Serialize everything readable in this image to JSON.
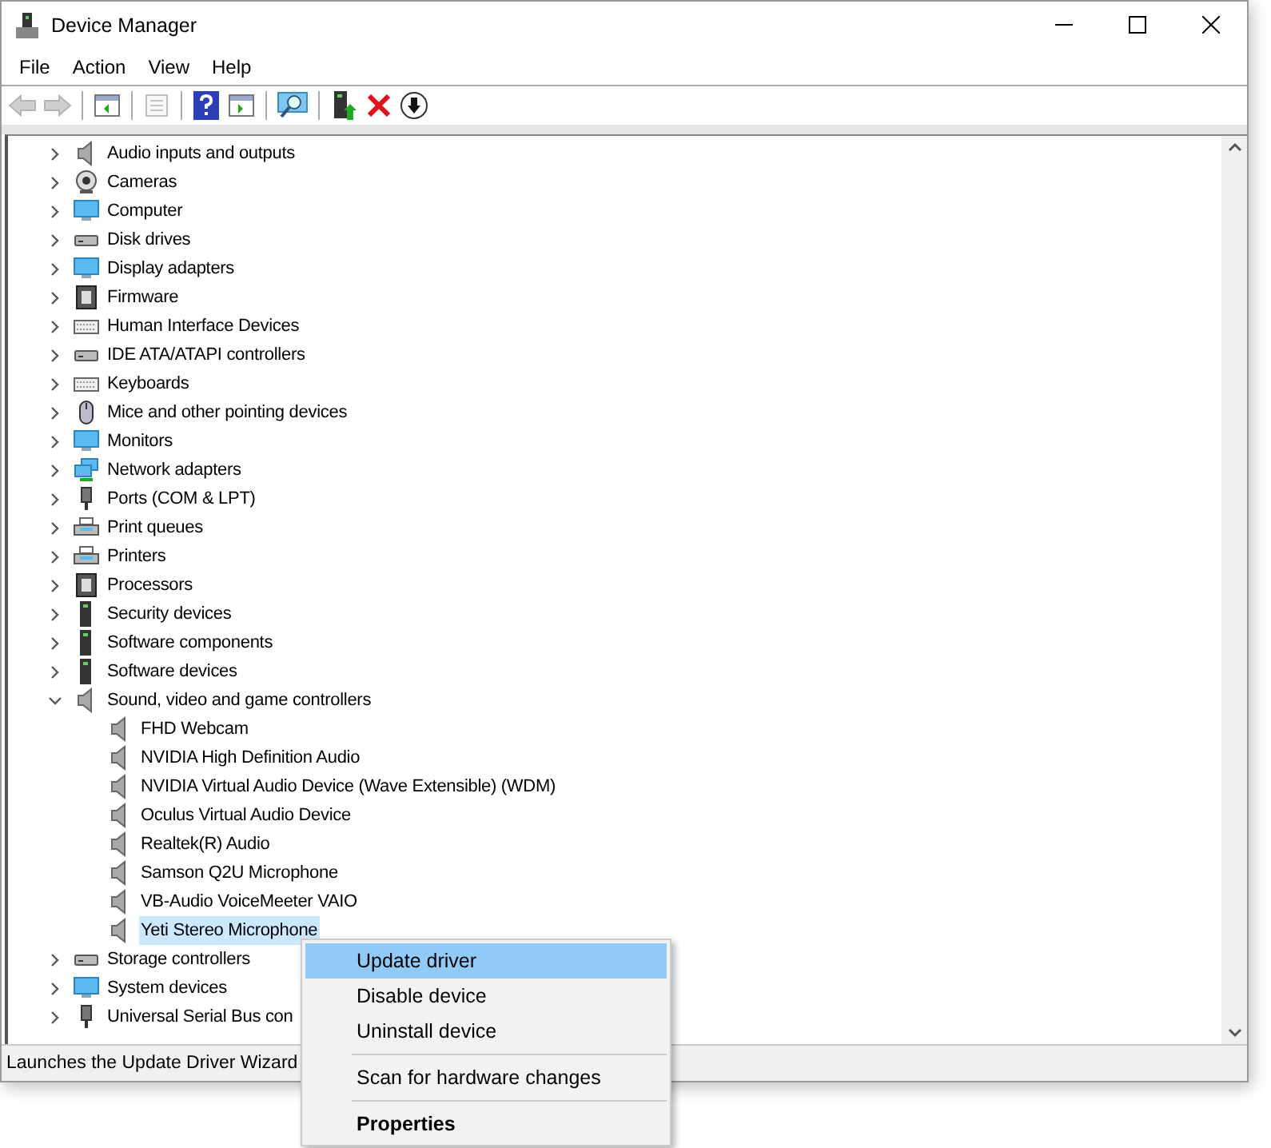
{
  "window": {
    "title": "Device Manager"
  },
  "menu": [
    "File",
    "Action",
    "View",
    "Help"
  ],
  "toolbar": [
    {
      "kind": "back",
      "disabled": true
    },
    {
      "kind": "forward",
      "disabled": true
    },
    {
      "kind": "separator"
    },
    {
      "kind": "tree",
      "disabled": false
    },
    {
      "kind": "separator"
    },
    {
      "kind": "properties",
      "disabled": true
    },
    {
      "kind": "separator"
    },
    {
      "kind": "help",
      "disabled": false
    },
    {
      "kind": "pane",
      "disabled": false
    },
    {
      "kind": "separator"
    },
    {
      "kind": "scan",
      "disabled": false
    },
    {
      "kind": "separator"
    },
    {
      "kind": "update",
      "disabled": false
    },
    {
      "kind": "uninstall",
      "disabled": false
    },
    {
      "kind": "disable",
      "disabled": false
    }
  ],
  "tree": [
    {
      "label": "Audio inputs and outputs",
      "expanded": false,
      "selected": false
    },
    {
      "label": "Cameras",
      "expanded": false,
      "selected": false
    },
    {
      "label": "Computer",
      "expanded": false,
      "selected": false
    },
    {
      "label": "Disk drives",
      "expanded": false,
      "selected": false
    },
    {
      "label": "Display adapters",
      "expanded": false,
      "selected": false
    },
    {
      "label": "Firmware",
      "expanded": false,
      "selected": false
    },
    {
      "label": "Human Interface Devices",
      "expanded": false,
      "selected": false
    },
    {
      "label": "IDE ATA/ATAPI controllers",
      "expanded": false,
      "selected": false
    },
    {
      "label": "Keyboards",
      "expanded": false,
      "selected": false
    },
    {
      "label": "Mice and other pointing devices",
      "expanded": false,
      "selected": false
    },
    {
      "label": "Monitors",
      "expanded": false,
      "selected": false
    },
    {
      "label": "Network adapters",
      "expanded": false,
      "selected": false
    },
    {
      "label": "Ports (COM & LPT)",
      "expanded": false,
      "selected": false
    },
    {
      "label": "Print queues",
      "expanded": false,
      "selected": false
    },
    {
      "label": "Printers",
      "expanded": false,
      "selected": false
    },
    {
      "label": "Processors",
      "expanded": false,
      "selected": false
    },
    {
      "label": "Security devices",
      "expanded": false,
      "selected": false
    },
    {
      "label": "Software components",
      "expanded": false,
      "selected": false
    },
    {
      "label": "Software devices",
      "expanded": false,
      "selected": false
    },
    {
      "label": "Sound, video and game controllers",
      "expanded": true,
      "selected": false,
      "children": [
        {
          "label": "FHD Webcam",
          "selected": false
        },
        {
          "label": "NVIDIA High Definition Audio",
          "selected": false
        },
        {
          "label": "NVIDIA Virtual Audio Device (Wave Extensible) (WDM)",
          "selected": false
        },
        {
          "label": "Oculus Virtual Audio Device",
          "selected": false
        },
        {
          "label": "Realtek(R) Audio",
          "selected": false
        },
        {
          "label": "Samson Q2U Microphone",
          "selected": false
        },
        {
          "label": "VB-Audio VoiceMeeter VAIO",
          "selected": false
        },
        {
          "label": "Yeti Stereo Microphone",
          "selected": true
        }
      ]
    },
    {
      "label": "Storage controllers",
      "expanded": false,
      "selected": false
    },
    {
      "label": "System devices",
      "expanded": false,
      "selected": false
    },
    {
      "label": "Universal Serial Bus con",
      "expanded": false,
      "selected": false
    }
  ],
  "status_bar": "Launches the Update Driver Wizard",
  "context_menu": [
    {
      "kind": "item",
      "label": "Update driver",
      "selected": true,
      "default": false
    },
    {
      "kind": "item",
      "label": "Disable device",
      "selected": false,
      "default": false
    },
    {
      "kind": "item",
      "label": "Uninstall device",
      "selected": false,
      "default": false
    },
    {
      "kind": "separator"
    },
    {
      "kind": "item",
      "label": "Scan for hardware changes",
      "selected": false,
      "default": false
    },
    {
      "kind": "separator"
    },
    {
      "kind": "item",
      "label": "Properties",
      "selected": false,
      "default": true
    }
  ]
}
